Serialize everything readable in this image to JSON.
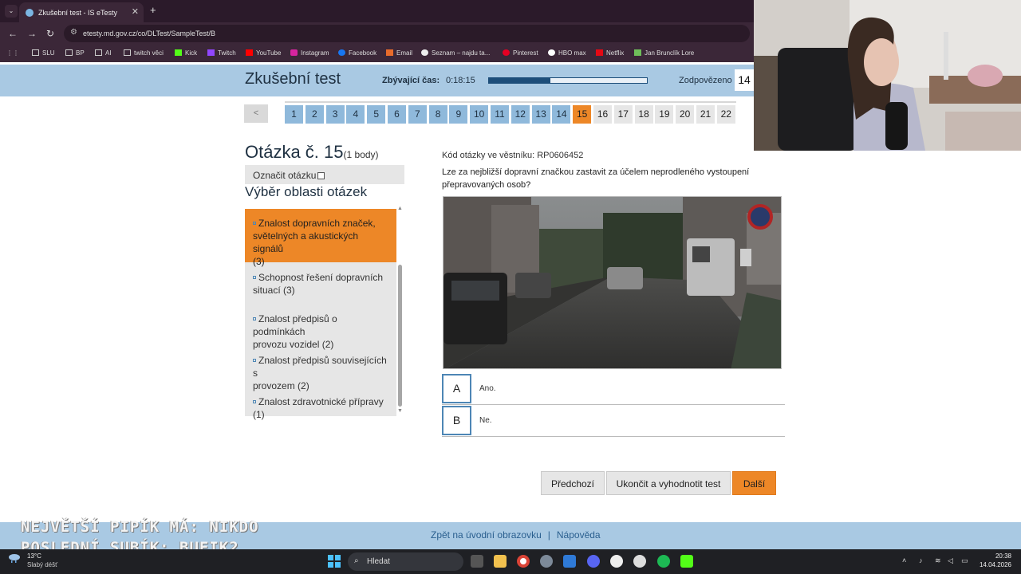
{
  "browser": {
    "tab_title": "Zkušební test - IS eTesty",
    "url": "etesty.md.gov.cz/co/DLTest/SampleTest/B",
    "bookmarks": [
      "SLU",
      "BP",
      "AI",
      "twitch věci",
      "Kick",
      "Twitch",
      "YouTube",
      "Instagram",
      "Facebook",
      "Email",
      "Seznam – najdu ta...",
      "Pinterest",
      "HBO max",
      "Netflix",
      "Jan Brunclík Lore"
    ]
  },
  "header": {
    "title": "Zkušební test",
    "timer_label": "Zbývající čas:",
    "timer_value": "0:18:15",
    "time_progress": 0.39,
    "answered_label": "Zodpovězeno",
    "answered_count": "14"
  },
  "question_nav": {
    "prev": "<",
    "numbers": [
      "1",
      "2",
      "3",
      "4",
      "5",
      "6",
      "7",
      "8",
      "9",
      "10",
      "11",
      "12",
      "13",
      "14",
      "15",
      "16",
      "17",
      "18",
      "19",
      "20",
      "21",
      "22"
    ],
    "current": "15"
  },
  "question": {
    "heading": "Otázka č. 15",
    "points": "(1 body)",
    "mark_label": "Označit otázku",
    "code": "Kód otázky ve věstníku: RP0606452",
    "text": "Lze za nejbližší dopravní značkou zastavit za účelem neprodleného vystoupení přepravovaných osob?"
  },
  "areas": {
    "heading": "Výběr oblasti otázek",
    "items": [
      {
        "line1": "Znalost dopravních značek,",
        "line2": "světelných a akustických signálů",
        "line3": "(3)"
      },
      {
        "line1": "Schopnost řešení dopravních",
        "line2": "situací (3)"
      },
      {
        "line1": "Znalost předpisů o podmínkách",
        "line2": "provozu vozidel (2)"
      },
      {
        "line1": "Znalost předpisů souvisejících s",
        "line2": "provozem (2)"
      },
      {
        "line1": "Znalost zdravotnické přípravy (1)"
      }
    ]
  },
  "answers": [
    {
      "key": "A",
      "text": "Ano."
    },
    {
      "key": "B",
      "text": "Ne."
    }
  ],
  "buttons": {
    "previous": "Předchozí",
    "finish": "Ukončit a vyhodnotit test",
    "next": "Další"
  },
  "footer": {
    "home_link": "Zpět na úvodní obrazovku",
    "separator": "|",
    "help_link": "Nápověda"
  },
  "overlay": {
    "line1": "NEJVĚTŠÍ PIPÍK MÁ: NIKDO",
    "line2": "POSLEDNÍ SUBÍK: BUFIK2"
  },
  "taskbar": {
    "weather_temp": "13°C",
    "weather_desc": "Slabý déšť",
    "search_placeholder": "Hledat",
    "time": "20:38",
    "date": "14.04.2026"
  },
  "colors": {
    "header_band": "#a9c9e3",
    "accent_orange": "#ed8727",
    "nav_blue": "#8fb9db",
    "progress_blue": "#1d4e7a"
  }
}
